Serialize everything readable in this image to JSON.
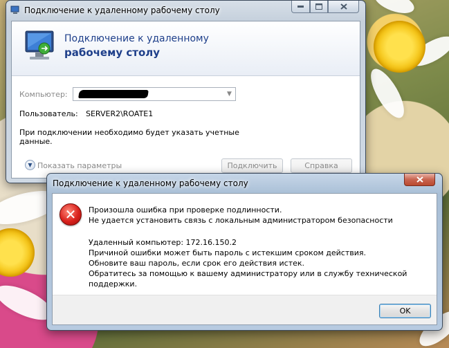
{
  "rdp_window": {
    "title": "Подключение к удаленному рабочему столу",
    "header_line1": "Подключение к удаленному",
    "header_line2": "рабочему столу",
    "computer_label": "Компьютер:",
    "computer_value": "",
    "user_label": "Пользователь:",
    "user_value": "SERVER2\\ROATE1",
    "note_line1": "При подключении необходимо будет указать учетные",
    "note_line2": "данные.",
    "options_label": "Показать параметры",
    "connect_button": "Подключить",
    "help_button": "Справка"
  },
  "error_dialog": {
    "title": "Подключение к удаленному рабочему столу",
    "line1": "Произошла ошибка при проверке подлинности.",
    "line2": "Не удается установить связь с локальным администратором безопасности",
    "line3": "Удаленный компьютер: 172.16.150.2",
    "line4": "Причиной ошибки может быть пароль с истекшим сроком действия.",
    "line5": "Обновите ваш пароль, если срок его действия истек.",
    "line6": "Обратитесь за помощью к вашему администратору или в службу технической",
    "line7": "поддержки.",
    "ok_button": "OK"
  },
  "icons": {
    "error": "error-icon",
    "rdp": "remote-desktop-icon"
  },
  "colors": {
    "header_text": "#1e3f8a",
    "error_red": "#d9211c"
  }
}
